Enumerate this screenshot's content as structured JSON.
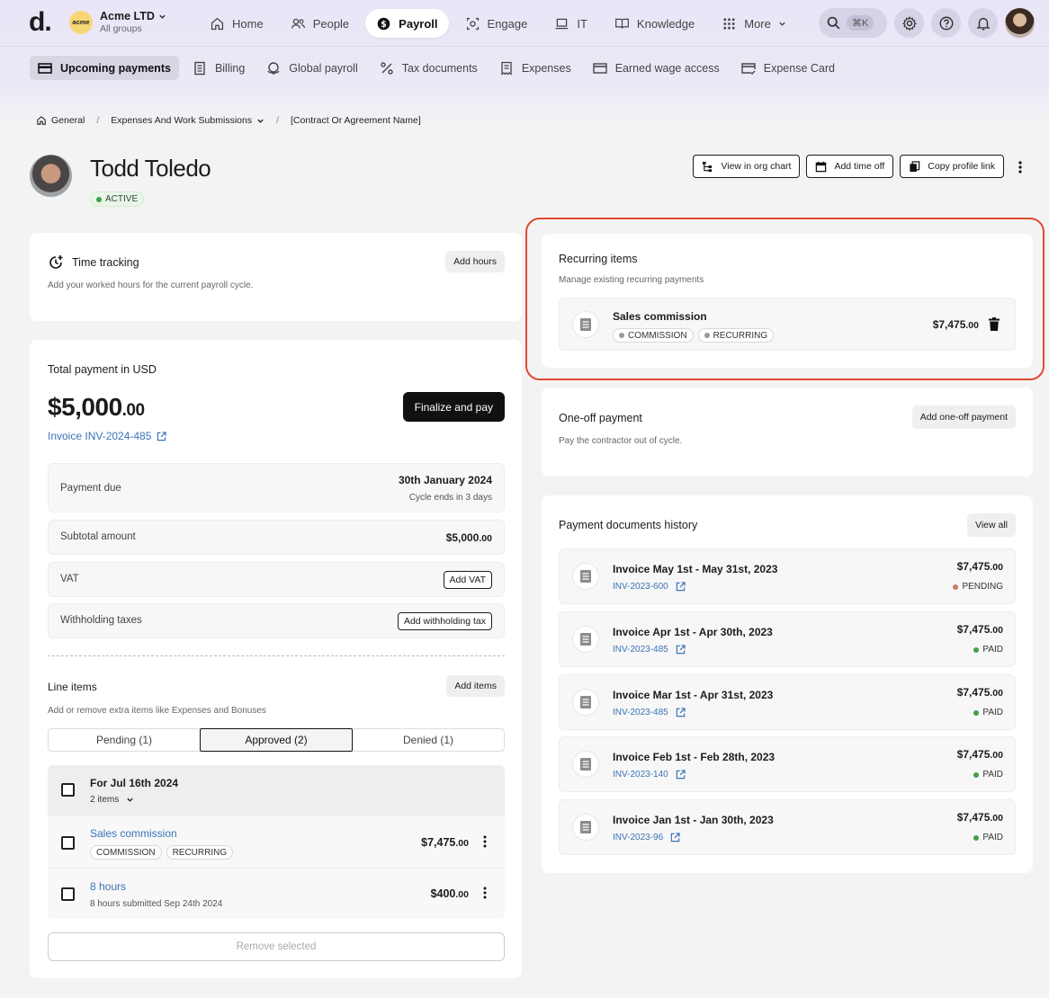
{
  "brand": {
    "logo": "d.",
    "org_badge": "acme",
    "org_name": "Acme LTD",
    "org_sub": "All groups"
  },
  "nav": {
    "items": [
      {
        "label": "Home"
      },
      {
        "label": "People"
      },
      {
        "label": "Payroll"
      },
      {
        "label": "Engage"
      },
      {
        "label": "IT"
      },
      {
        "label": "Knowledge"
      },
      {
        "label": "More"
      }
    ],
    "active": "Payroll",
    "search_shortcut": "⌘K"
  },
  "subnav": {
    "items": [
      {
        "label": "Upcoming payments"
      },
      {
        "label": "Billing"
      },
      {
        "label": "Global payroll"
      },
      {
        "label": "Tax documents"
      },
      {
        "label": "Expenses"
      },
      {
        "label": "Earned wage access"
      },
      {
        "label": "Expense Card"
      }
    ]
  },
  "breadcrumb": {
    "home": "General",
    "middle": "Expenses And Work Submissions",
    "current": "[Contract Or Agreement Name]"
  },
  "profile": {
    "name": "Todd Toledo",
    "status": "ACTIVE",
    "actions": {
      "org_chart": "View in org chart",
      "time_off": "Add time off",
      "copy_link": "Copy profile link"
    }
  },
  "time_tracking": {
    "title": "Time tracking",
    "subtitle": "Add your worked hours for the current payroll cycle.",
    "button": "Add hours"
  },
  "payment": {
    "title": "Total payment in USD",
    "amount_main": "$5,000",
    "amount_cents": ".00",
    "finalize": "Finalize and pay",
    "invoice_link": "Invoice INV-2024-485",
    "due_label": "Payment due",
    "due_date": "30th January 2024",
    "cycle_note": "Cycle ends in 3 days",
    "subtotal_label": "Subtotal amount",
    "subtotal_main": "$5,000",
    "subtotal_cents": ".00",
    "vat_label": "VAT",
    "vat_button": "Add VAT",
    "withholding_label": "Withholding taxes",
    "withholding_button": "Add withholding tax"
  },
  "line_items": {
    "title": "Line items",
    "subtitle": "Add or remove extra items like Expenses and Bonuses",
    "button": "Add items",
    "tabs": [
      "Pending (1)",
      "Approved (2)",
      "Denied (1)"
    ],
    "active_tab": "Approved (2)",
    "group_title": "For Jul 16th 2024",
    "group_count": "2 items",
    "rows": [
      {
        "title": "Sales commission",
        "tags": [
          "COMMISSION",
          "RECURRING"
        ],
        "amount_main": "$7,475",
        "amount_cents": ".00"
      },
      {
        "title": "8 hours",
        "sub": "8 hours submitted Sep 24th 2024",
        "amount_main": "$400",
        "amount_cents": ".00"
      }
    ],
    "remove_button": "Remove selected"
  },
  "recurring": {
    "title": "Recurring items",
    "subtitle": "Manage existing recurring payments",
    "item": {
      "title": "Sales commission",
      "tags": [
        "COMMISSION",
        "RECURRING"
      ],
      "amount_main": "$7,475",
      "amount_cents": ".00"
    },
    "highlight_color": "#e04a2f"
  },
  "one_off": {
    "title": "One-off payment",
    "subtitle": "Pay the contractor out of cycle.",
    "button": "Add one-off payment"
  },
  "history": {
    "title": "Payment documents history",
    "button": "View all",
    "items": [
      {
        "title": "Invoice May 1st - May 31st, 2023",
        "ref": "INV-2023-600",
        "amount_main": "$7,475",
        "amount_cents": ".00",
        "status": "PENDING",
        "status_color": "#c97b6a"
      },
      {
        "title": "Invoice Apr 1st - Apr 30th, 2023",
        "ref": "INV-2023-485",
        "amount_main": "$7,475",
        "amount_cents": ".00",
        "status": "PAID",
        "status_color": "#3fa04a"
      },
      {
        "title": "Invoice Mar 1st - Apr 31st, 2023",
        "ref": "INV-2023-485",
        "amount_main": "$7,475",
        "amount_cents": ".00",
        "status": "PAID",
        "status_color": "#3fa04a"
      },
      {
        "title": "Invoice Feb 1st - Feb 28th, 2023",
        "ref": "INV-2023-140",
        "amount_main": "$7,475",
        "amount_cents": ".00",
        "status": "PAID",
        "status_color": "#3fa04a"
      },
      {
        "title": "Invoice Jan 1st - Jan 30th, 2023",
        "ref": "INV-2023-96",
        "amount_main": "$7,475",
        "amount_cents": ".00",
        "status": "PAID",
        "status_color": "#3fa04a"
      }
    ]
  }
}
